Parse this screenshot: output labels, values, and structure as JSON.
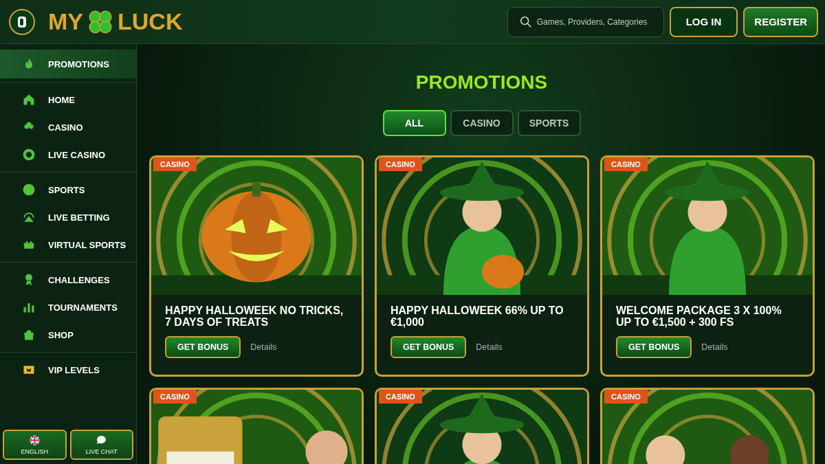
{
  "header": {
    "logo": {
      "left": "MY",
      "right": "LUCK"
    },
    "search": {
      "placeholder": "Games, Providers, Categories"
    },
    "buttons": [
      {
        "label": "LOG IN",
        "kind": "login"
      },
      {
        "label": "REGISTER",
        "kind": "register"
      }
    ]
  },
  "sidebar": {
    "groups": [
      [
        {
          "label": "PROMOTIONS",
          "selected": true
        }
      ],
      [
        {
          "label": "HOME",
          "selected": false
        },
        {
          "label": "CASINO",
          "selected": false
        },
        {
          "label": "LIVE CASINO",
          "selected": false
        }
      ],
      [
        {
          "label": "SPORTS",
          "selected": false
        },
        {
          "label": "LIVE BETTING",
          "selected": false
        },
        {
          "label": "VIRTUAL SPORTS",
          "selected": false
        }
      ],
      [
        {
          "label": "CHALLENGES",
          "selected": false
        },
        {
          "label": "TOURNAMENTS",
          "selected": false
        },
        {
          "label": "SHOP",
          "selected": false
        }
      ],
      [
        {
          "label": "VIP LEVELS",
          "selected": false
        }
      ]
    ],
    "footer_buttons": [
      {
        "label": "ENGLISH",
        "kind": "language"
      },
      {
        "label": "LIVE CHAT",
        "kind": "chat"
      }
    ]
  },
  "main": {
    "title": "PROMOTIONS",
    "filters": [
      {
        "label": "ALL",
        "selected": true
      },
      {
        "label": "CASINO",
        "selected": false
      },
      {
        "label": "SPORTS",
        "selected": false
      }
    ],
    "cards": [
      {
        "tag": "CASINO",
        "title": "HAPPY HALLOWEEK NO TRICKS, 7 DAYS OF TREATS",
        "button": "GET BONUS",
        "link": "Details",
        "kind": "picture"
      },
      {
        "tag": "CASINO",
        "title": "HAPPY HALLOWEEK 66% UP TO €1,000",
        "button": "GET BONUS",
        "link": "Details",
        "kind": "picture"
      },
      {
        "tag": "CASINO",
        "title": "WELCOME PACKAGE 3 X 100% UP TO €1,500 + 300 FS",
        "button": "GET BONUS",
        "link": "Details",
        "kind": "picture"
      },
      {
        "tag": "CASINO",
        "kind": "picture"
      },
      {
        "tag": "CASINO",
        "kind": "picture"
      },
      {
        "tag": "CASINO",
        "kind": "picture"
      }
    ]
  }
}
